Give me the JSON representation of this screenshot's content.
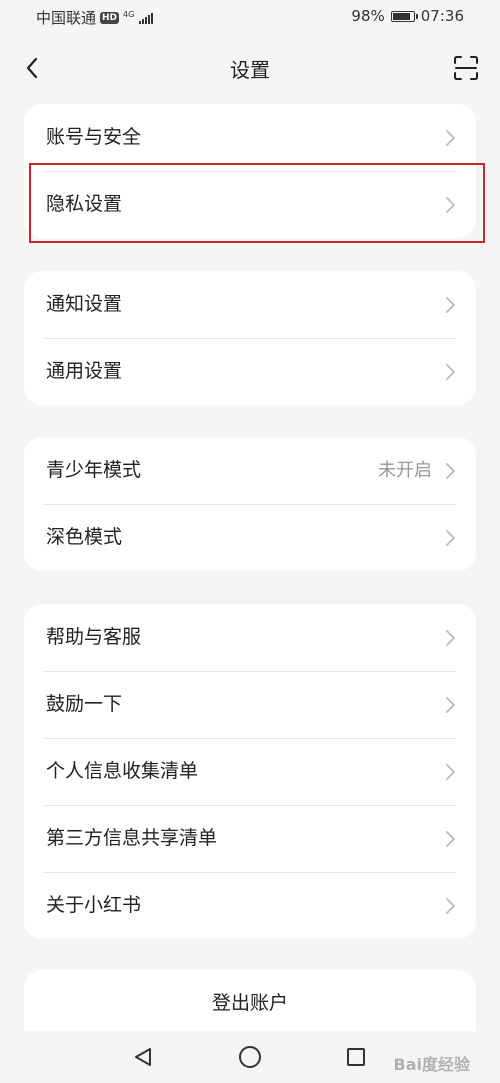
{
  "status_bar": {
    "carrier": "中国联通",
    "hd_badge": "HD",
    "network": "4G",
    "battery_percent_text": "98%",
    "battery_level": 0.98,
    "time": "07:36"
  },
  "navbar": {
    "back_icon": "chevron-left-icon",
    "title": "设置",
    "scan_icon": "scan-icon"
  },
  "groups": [
    {
      "items": [
        {
          "label": "账号与安全"
        },
        {
          "label": "隐私设置",
          "highlighted": true
        }
      ]
    },
    {
      "items": [
        {
          "label": "通知设置"
        },
        {
          "label": "通用设置"
        }
      ]
    },
    {
      "items": [
        {
          "label": "青少年模式",
          "value": "未开启"
        },
        {
          "label": "深色模式"
        }
      ]
    },
    {
      "items": [
        {
          "label": "帮助与客服"
        },
        {
          "label": "鼓励一下"
        },
        {
          "label": "个人信息收集清单"
        },
        {
          "label": "第三方信息共享清单"
        },
        {
          "label": "关于小红书"
        }
      ]
    }
  ],
  "logout_label": "登出账户",
  "system_nav": {
    "back_icon": "triangle-back-icon",
    "home_icon": "circle-home-icon",
    "recents_icon": "square-recents-icon"
  },
  "watermark": "Bai度经验",
  "colors": {
    "background": "#f5f5f5",
    "card": "#ffffff",
    "highlight": "#c8262b",
    "secondary_text": "#999999"
  }
}
